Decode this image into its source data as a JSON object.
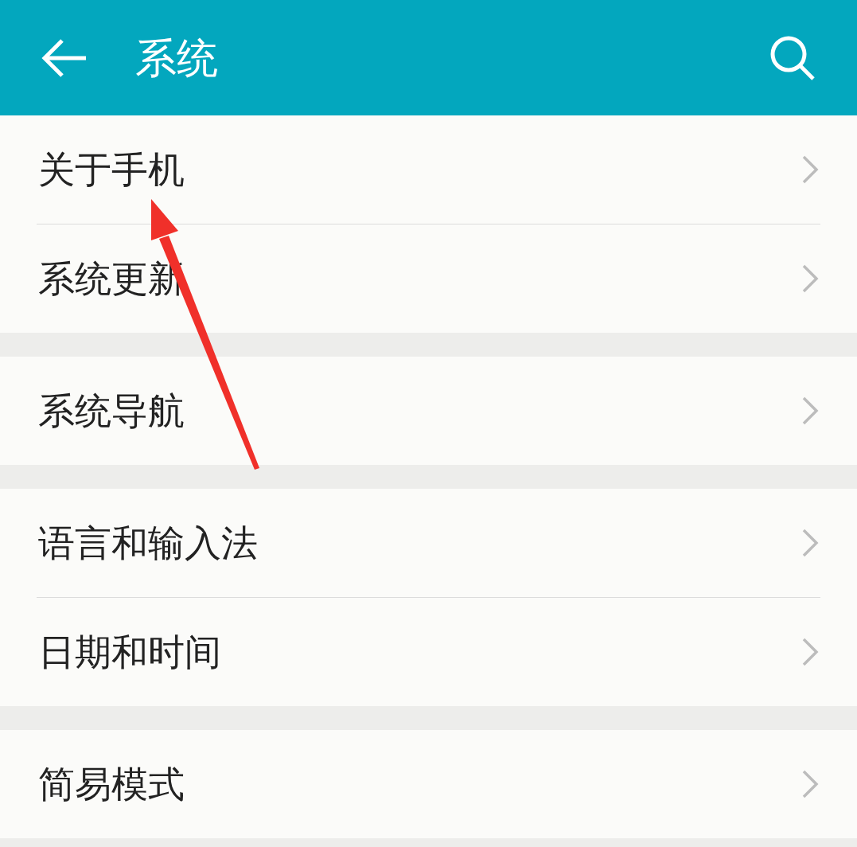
{
  "header": {
    "title": "系统"
  },
  "groups": [
    {
      "items": [
        {
          "label": "关于手机"
        },
        {
          "label": "系统更新"
        }
      ]
    },
    {
      "items": [
        {
          "label": "系统导航"
        }
      ]
    },
    {
      "items": [
        {
          "label": "语言和输入法"
        },
        {
          "label": "日期和时间"
        }
      ]
    },
    {
      "items": [
        {
          "label": "简易模式"
        }
      ]
    }
  ],
  "annotations": [
    {
      "kind": "arrow",
      "color": "#f0302a"
    }
  ]
}
